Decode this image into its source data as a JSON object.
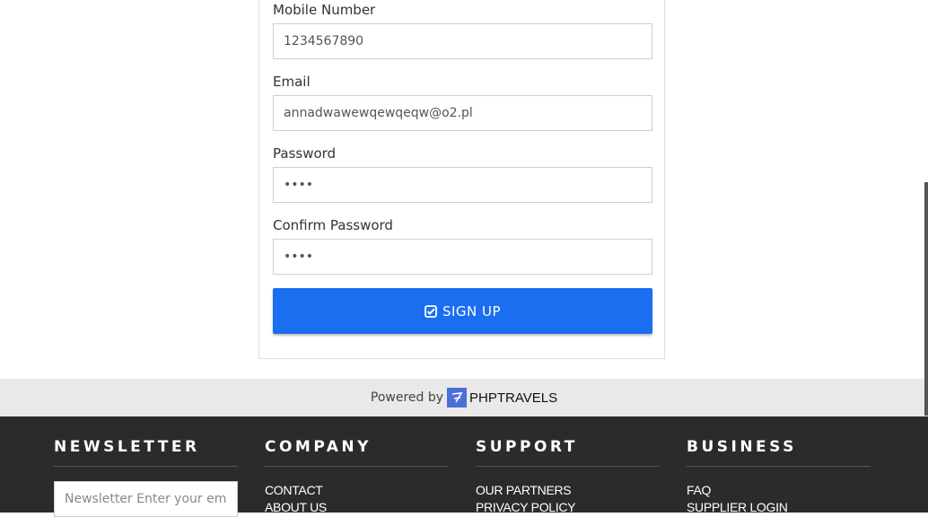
{
  "form": {
    "mobile_label": "Mobile Number",
    "mobile_value": "1234567890",
    "email_label": "Email",
    "email_value": "annadwawewqewqeqw@o2.pl",
    "password_label": "Password",
    "password_value": "••••",
    "confirm_label": "Confirm Password",
    "confirm_value": "••••",
    "signup_label": "SIGN UP",
    "signup_icon": "check-square-icon"
  },
  "powered": {
    "text": "Powered by",
    "brand": "PHPTRAVELS"
  },
  "footer": {
    "newsletter": {
      "title": "NEWSLETTER",
      "placeholder": "Newsletter Enter your email"
    },
    "company": {
      "title": "COMPANY",
      "links": [
        "CONTACT",
        "ABOUT US"
      ]
    },
    "support": {
      "title": "SUPPORT",
      "links": [
        "OUR PARTNERS",
        "PRIVACY POLICY"
      ]
    },
    "business": {
      "title": "BUSINESS",
      "links": [
        "FAQ",
        "SUPPLIER LOGIN"
      ]
    }
  },
  "colors": {
    "accent": "#1a6ef0",
    "footer_bg": "#2b2b2b",
    "powered_bg": "#e9e9e9"
  }
}
